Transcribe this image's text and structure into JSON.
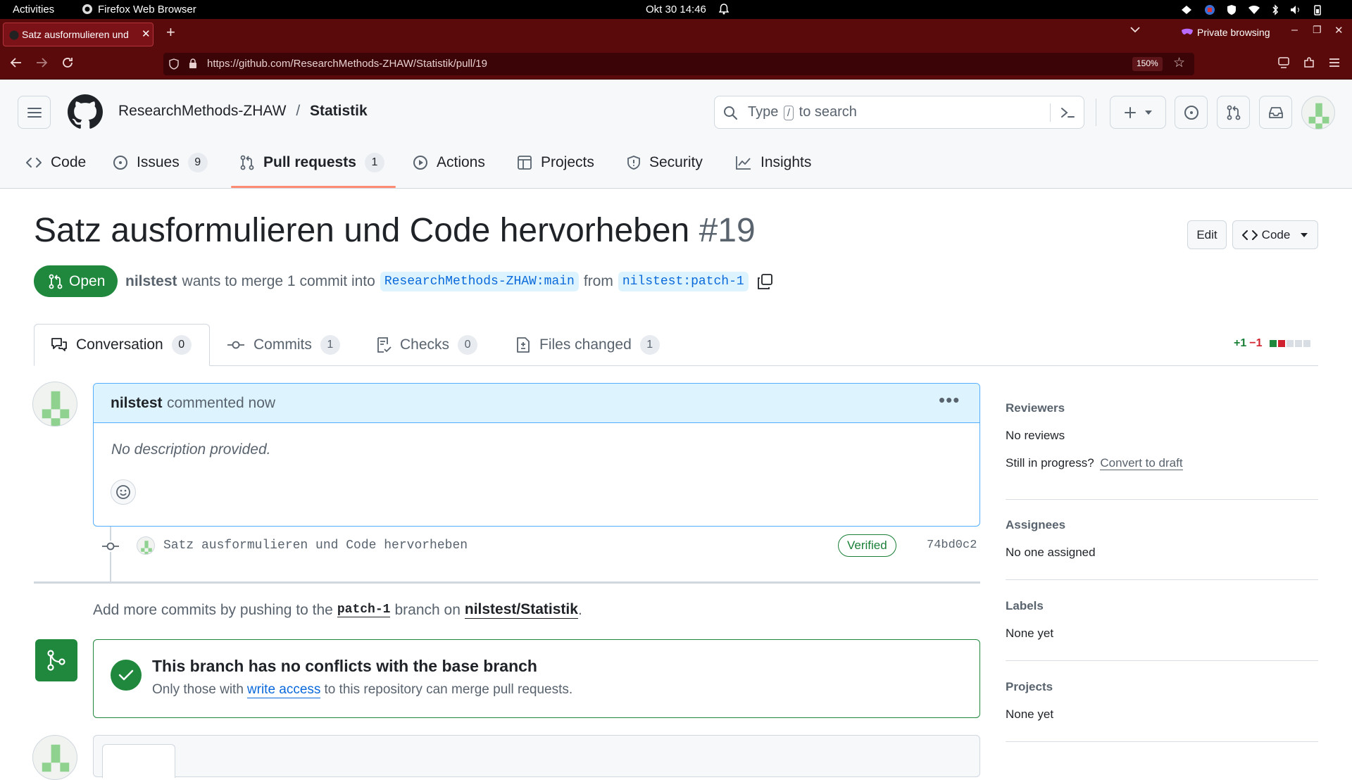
{
  "system": {
    "activities": "Activities",
    "app_name": "Firefox Web Browser",
    "clock": "Okt 30  14:46"
  },
  "browser": {
    "tab_title": "Satz ausformulieren und",
    "private_label": "Private browsing",
    "url": "https://github.com/ResearchMethods-ZHAW/Statistik/pull/19",
    "zoom": "150%"
  },
  "repo": {
    "owner": "ResearchMethods-ZHAW",
    "separator": "/",
    "name": "Statistik"
  },
  "search": {
    "placeholder_pre": "Type",
    "slash": "/",
    "placeholder_post": "to search"
  },
  "repo_nav": [
    {
      "label": "Code",
      "icon": "code-icon"
    },
    {
      "label": "Issues",
      "count": "9",
      "icon": "issue-icon"
    },
    {
      "label": "Pull requests",
      "count": "1",
      "icon": "pull-request-icon",
      "selected": true
    },
    {
      "label": "Actions",
      "icon": "play-icon"
    },
    {
      "label": "Projects",
      "icon": "table-icon"
    },
    {
      "label": "Security",
      "icon": "shield-icon"
    },
    {
      "label": "Insights",
      "icon": "graph-icon"
    }
  ],
  "pr": {
    "title": "Satz ausformulieren und Code hervorheben",
    "number": "#19",
    "state": "Open",
    "author": "nilstest",
    "merge_text": "wants to merge 1 commit into",
    "base": "ResearchMethods-ZHAW:main",
    "from_text": "from",
    "head": "nilstest:patch-1",
    "edit_label": "Edit",
    "code_label": "Code"
  },
  "pr_tabs": [
    {
      "label": "Conversation",
      "count": "0",
      "icon": "comment-discussion-icon"
    },
    {
      "label": "Commits",
      "count": "1",
      "icon": "git-commit-icon"
    },
    {
      "label": "Checks",
      "count": "0",
      "icon": "checklist-icon"
    },
    {
      "label": "Files changed",
      "count": "1",
      "icon": "file-diff-icon"
    }
  ],
  "diffstat": {
    "additions": "+1",
    "deletions": "−1"
  },
  "comment": {
    "author": "nilstest",
    "action": "commented now",
    "body": "No description provided."
  },
  "commit": {
    "message": "Satz ausformulieren und Code hervorheben",
    "verified": "Verified",
    "sha": "74bd0c2"
  },
  "push_hint": {
    "pre": "Add more commits by pushing to the",
    "branch": "patch-1",
    "mid": "branch on",
    "repo": "nilstest/Statistik",
    "post": "."
  },
  "merge_box": {
    "title": "This branch has no conflicts with the base branch",
    "pre": "Only those with",
    "link": "write access",
    "post": "to this repository can merge pull requests."
  },
  "sidebar": {
    "reviewers": {
      "heading": "Reviewers",
      "value": "No reviews",
      "hint": "Still in progress?",
      "link": "Convert to draft"
    },
    "assignees": {
      "heading": "Assignees",
      "value": "No one assigned"
    },
    "labels": {
      "heading": "Labels",
      "value": "None yet"
    },
    "projects": {
      "heading": "Projects",
      "value": "None yet"
    }
  },
  "colors": {
    "open_green": "#1f883d",
    "link_blue": "#0969da",
    "accent_orange": "#fd8c73",
    "firefox_private": "#5a0a0a"
  }
}
